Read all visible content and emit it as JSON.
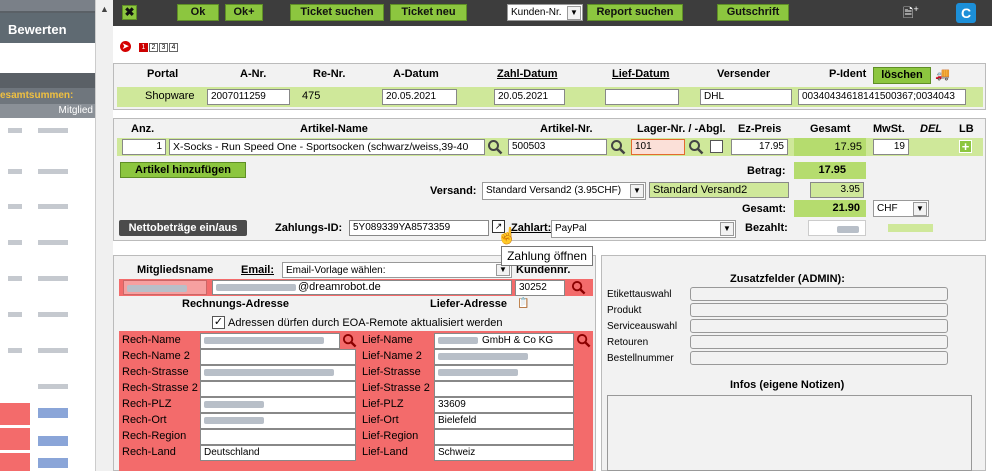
{
  "sidebar": {
    "bewerten_label": "Bewerten",
    "gesamtsummen_label": "esamtsummen:",
    "mitglied_label": "Mitglied"
  },
  "toolbar": {
    "ok": "Ok",
    "ok_plus": "Ok+",
    "ticket_suchen": "Ticket suchen",
    "ticket_neu": "Ticket neu",
    "kunden_nr": "Kunden-Nr.",
    "report_suchen": "Report suchen",
    "gutschrift": "Gutschrift"
  },
  "pages": [
    "1",
    "2",
    "3",
    "4"
  ],
  "order": {
    "headers": {
      "portal": "Portal",
      "a_nr": "A-Nr.",
      "re_nr": "Re-Nr.",
      "a_datum": "A-Datum",
      "zahl_datum": "Zahl-Datum",
      "lief_datum": "Lief-Datum",
      "versender": "Versender",
      "p_ident": "P-Ident"
    },
    "values": {
      "portal": "Shopware",
      "a_nr": "2007011259",
      "re_nr": "475",
      "a_datum": "20.05.2021",
      "zahl_datum": "20.05.2021",
      "lief_datum": "",
      "versender": "DHL",
      "p_ident": "00340434618141500367;0034043"
    },
    "loeschen": "löschen"
  },
  "article": {
    "headers": {
      "anz": "Anz.",
      "name": "Artikel-Name",
      "nr": "Artikel-Nr.",
      "lager": "Lager-Nr. / -Abgl.",
      "ez": "Ez-Preis",
      "gesamt": "Gesamt",
      "mwst": "MwSt.",
      "del": "DEL",
      "lb": "LB"
    },
    "values": {
      "anz": "1",
      "name": "X-Socks - Run Speed One - Sportsocken (schwarz/weiss,39-40",
      "nr": "500503",
      "lager": "101",
      "ez": "17.95",
      "gesamt": "17.95",
      "mwst": "19"
    },
    "add_button": "Artikel hinzufügen",
    "betrag_label": "Betrag:",
    "betrag": "17.95",
    "versand_label": "Versand:",
    "versand_select": "Standard Versand2 (3.95CHF)",
    "versand_name": "Standard Versand2",
    "versand_price": "3.95",
    "gesamt_label": "Gesamt:",
    "gesamt": "21.90",
    "currency": "CHF",
    "netto_button": "Nettobeträge ein/aus",
    "zahlungs_id_label": "Zahlungs-ID:",
    "zahlungs_id": "5Y089339YA8573359",
    "zahlart_label": "Zahlart:",
    "zahlart": "PayPal",
    "bezahlt_label": "Bezahlt:",
    "tooltip": "Zahlung öffnen"
  },
  "member": {
    "name_label": "Mitgliedsname",
    "email_label": "Email:",
    "email_select": "Email-Vorlage wählen:",
    "kundennr_label": "Kundennr.",
    "kundennr": "30252",
    "email_domain": "@dreamrobot.de",
    "rech_title": "Rechnungs-Adresse",
    "lief_title": "Liefer-Adresse",
    "checkbox_label": "Adressen dürfen durch EOA-Remote aktualisiert werden"
  },
  "address": {
    "rech_labels": [
      "Rech-Name",
      "Rech-Name 2",
      "Rech-Strasse",
      "Rech-Strasse 2",
      "Rech-PLZ",
      "Rech-Ort",
      "Rech-Region",
      "Rech-Land"
    ],
    "lief_labels": [
      "Lief-Name",
      "Lief-Name 2",
      "Lief-Strasse",
      "Lief-Strasse 2",
      "Lief-PLZ",
      "Lief-Ort",
      "Lief-Region",
      "Lief-Land"
    ],
    "rech_values": [
      "",
      "",
      "",
      "",
      "",
      "",
      "",
      "Deutschland"
    ],
    "lief_values": [
      "GmbH & Co KG",
      "",
      "",
      "",
      "33609",
      "Bielefeld",
      "",
      "Schweiz"
    ]
  },
  "extra": {
    "title": "Zusatzfelder (ADMIN):",
    "fields": [
      "Etikettauswahl",
      "Produkt",
      "Serviceauswahl",
      "Retouren",
      "Bestellnummer"
    ],
    "notes_title": "Infos (eigene Notizen)"
  }
}
